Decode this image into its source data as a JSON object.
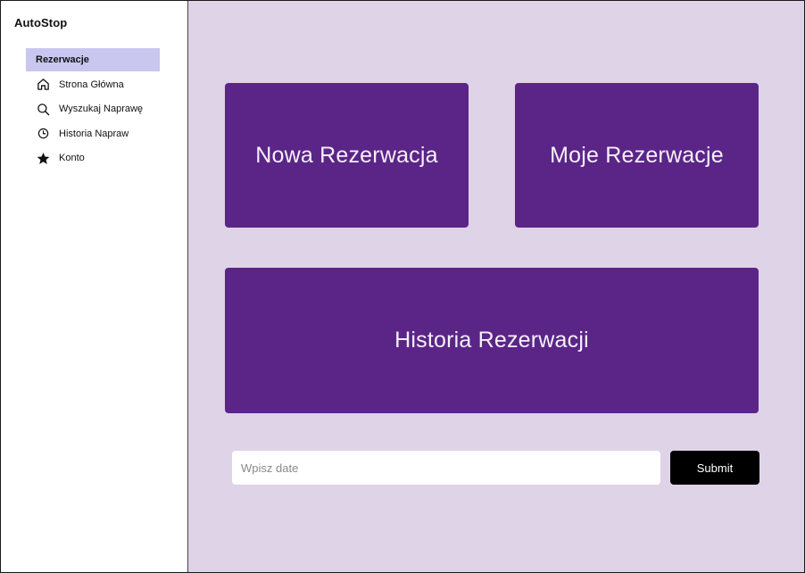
{
  "app": {
    "title": "AutoStop"
  },
  "sidebar": {
    "items": [
      {
        "label": "Rezerwacje",
        "icon": "none",
        "active": true
      },
      {
        "label": "Strona Główna",
        "icon": "home-icon",
        "active": false
      },
      {
        "label": "Wyszukaj Naprawę",
        "icon": "search-icon",
        "active": false
      },
      {
        "label": "Historia Napraw",
        "icon": "clock-icon",
        "active": false
      },
      {
        "label": "Konto",
        "icon": "star-icon",
        "active": false
      }
    ]
  },
  "main": {
    "cards": {
      "new_reservation": "Nowa Rezerwacja",
      "my_reservations": "Moje Rezerwacje",
      "reservation_history": "Historia Rezerwacji"
    },
    "date_input": {
      "value": "",
      "placeholder": "Wpisz date"
    },
    "submit_label": "Submit"
  },
  "colors": {
    "main_background": "#dfd3e7",
    "card": "#5b2587",
    "active_nav": "#c9c6f0",
    "submit_button": "#000000"
  }
}
